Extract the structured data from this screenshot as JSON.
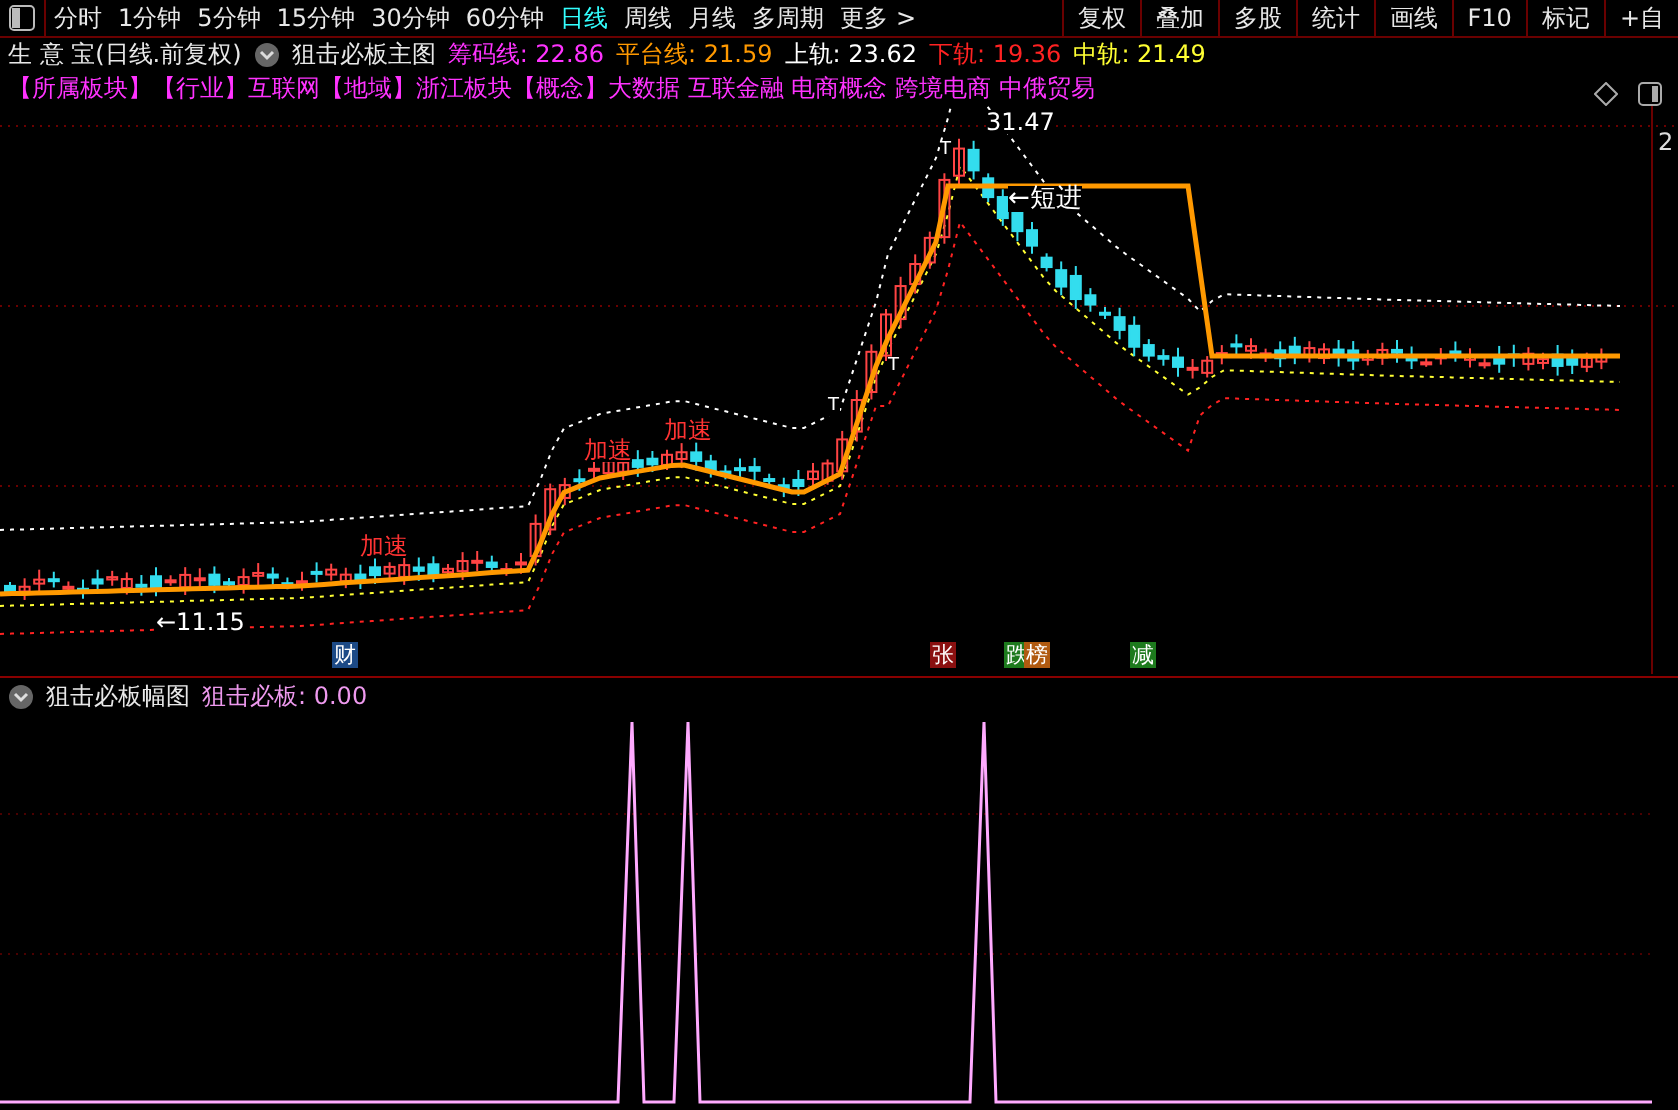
{
  "toolbar": {
    "periods": [
      {
        "label": "分时",
        "selected": false
      },
      {
        "label": "1分钟",
        "selected": false
      },
      {
        "label": "5分钟",
        "selected": false
      },
      {
        "label": "15分钟",
        "selected": false
      },
      {
        "label": "30分钟",
        "selected": false
      },
      {
        "label": "60分钟",
        "selected": false
      },
      {
        "label": "日线",
        "selected": true
      },
      {
        "label": "周线",
        "selected": false
      },
      {
        "label": "月线",
        "selected": false
      },
      {
        "label": "多周期",
        "selected": false
      }
    ],
    "more": "更多 >",
    "buttons": [
      "复权",
      "叠加",
      "多股",
      "统计",
      "画线",
      "F10",
      "标记",
      "+自"
    ]
  },
  "main_chart": {
    "stock": "生 意 宝(日线.前复权)",
    "indicator": "狙击必板主图",
    "readings": [
      {
        "label": "筹码线: 22.86",
        "color": "#ff33ff"
      },
      {
        "label": "平台线: 21.59",
        "color": "#ff9900"
      },
      {
        "label": "上轨: 23.62",
        "color": "#ffffff"
      },
      {
        "label": "下轨: 19.36",
        "color": "#ff2222"
      },
      {
        "label": "中轨: 21.49",
        "color": "#ffff33"
      }
    ],
    "concepts": "【所属板块】【行业】互联网【地域】浙江板块【概念】大数据 互联金融 电商概念 跨境电商 中俄贸易",
    "axis_label": "2",
    "annotations": [
      {
        "text": "31.47",
        "kind": "price"
      },
      {
        "text": "T",
        "kind": "marker"
      },
      {
        "text": "T",
        "kind": "marker"
      },
      {
        "text": "T",
        "kind": "marker"
      },
      {
        "text": "←短进",
        "kind": "signal"
      },
      {
        "text": "←11.15",
        "kind": "price"
      },
      {
        "text": "加速",
        "kind": "alert"
      },
      {
        "text": "加速",
        "kind": "alert"
      },
      {
        "text": "加速",
        "kind": "alert"
      }
    ],
    "events": [
      {
        "text": "财",
        "color": "#1c4a86"
      },
      {
        "text": "张",
        "color": "#8a1010"
      },
      {
        "text": "跌",
        "color": "#1d7a1d"
      },
      {
        "text": "榜",
        "color": "#b05a10"
      },
      {
        "text": "减",
        "color": "#1d7a1d"
      }
    ]
  },
  "sub_chart": {
    "indicator": "狙击必板幅图",
    "reading": "狙击必板: 0.00"
  }
}
